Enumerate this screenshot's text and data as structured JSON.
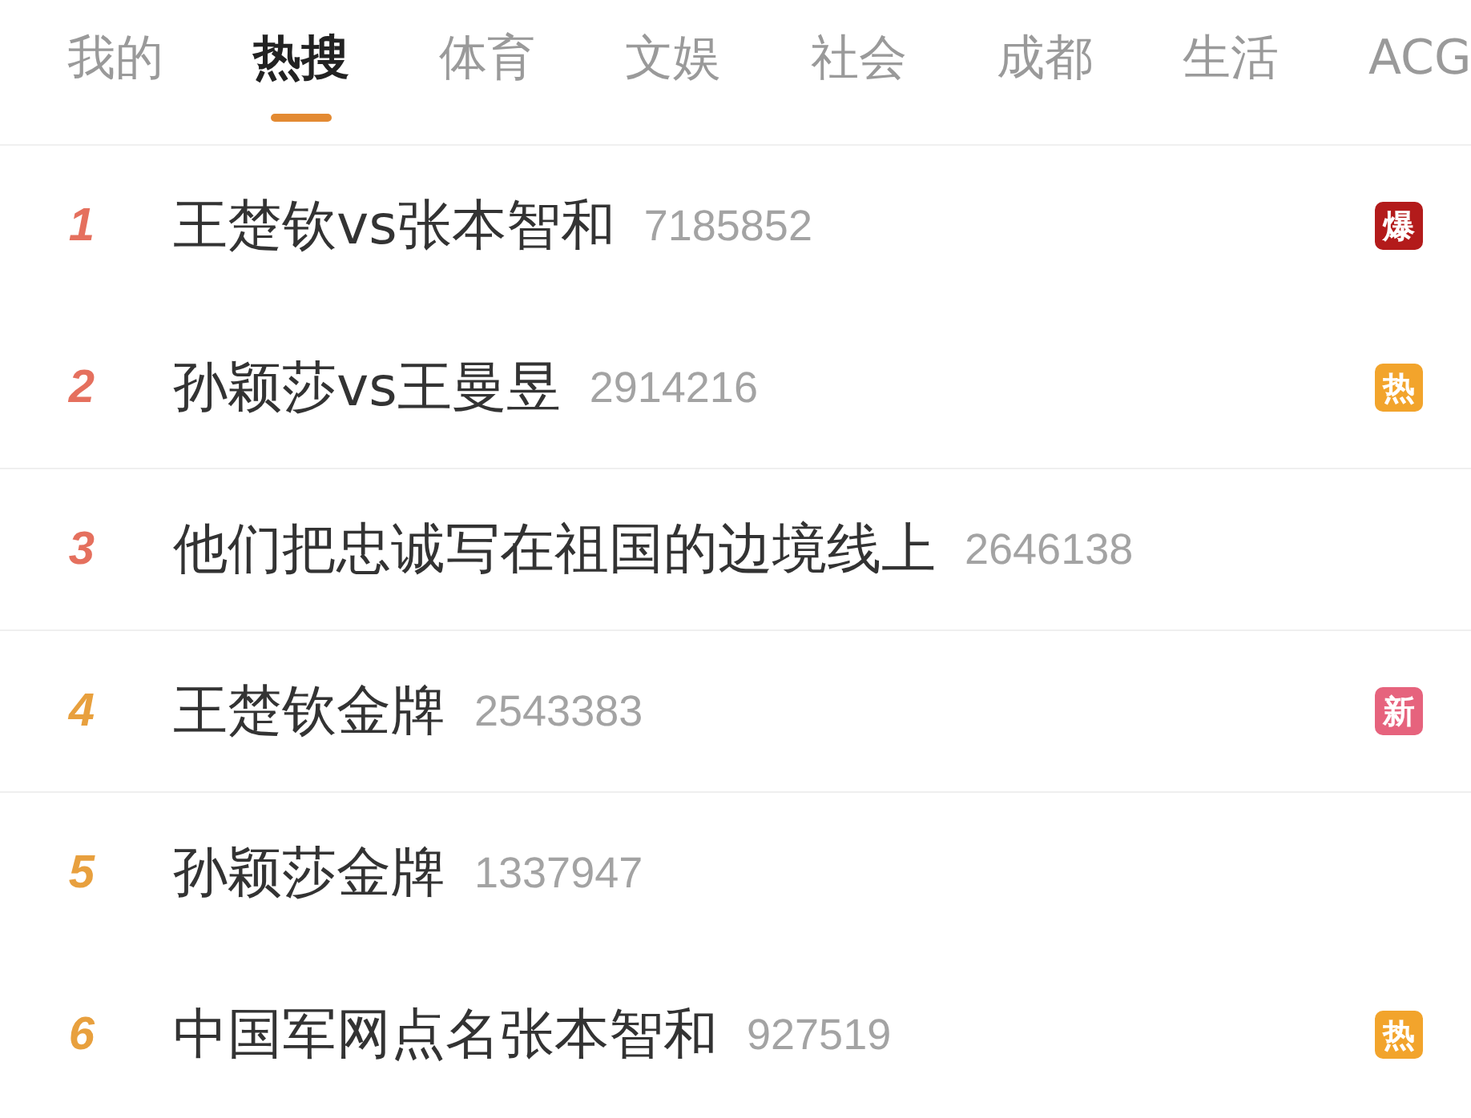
{
  "tabs": [
    {
      "label": "我的",
      "selected": false
    },
    {
      "label": "热搜",
      "selected": true
    },
    {
      "label": "体育",
      "selected": false
    },
    {
      "label": "文娱",
      "selected": false
    },
    {
      "label": "社会",
      "selected": false
    },
    {
      "label": "成都",
      "selected": false
    },
    {
      "label": "生活",
      "selected": false
    },
    {
      "label": "ACG",
      "selected": false
    }
  ],
  "rows": [
    {
      "rank": "1",
      "color": "#e5705e",
      "title": "王楚钦vs张本智和",
      "count": "7185852",
      "badge": {
        "text": "爆",
        "color": "#b31b1b"
      },
      "divider": false
    },
    {
      "rank": "2",
      "color": "#e5705e",
      "title": "孙颖莎vs王曼昱",
      "count": "2914216",
      "badge": {
        "text": "热",
        "color": "#f2a42c"
      },
      "divider": true
    },
    {
      "rank": "3",
      "color": "#e5705e",
      "title": "他们把忠诚写在祖国的边境线上",
      "count": "2646138",
      "divider": true
    },
    {
      "rank": "4",
      "color": "#e8a03e",
      "title": "王楚钦金牌",
      "count": "2543383",
      "badge": {
        "text": "新",
        "color": "#e6637d"
      },
      "divider": true
    },
    {
      "rank": "5",
      "color": "#e8a03e",
      "title": "孙颖莎金牌",
      "count": "1337947",
      "divider": false
    },
    {
      "rank": "6",
      "color": "#e8a03e",
      "title": "中国军网点名张本智和",
      "count": "927519",
      "badge": {
        "text": "热",
        "color": "#f2a42c"
      },
      "divider": false
    }
  ]
}
